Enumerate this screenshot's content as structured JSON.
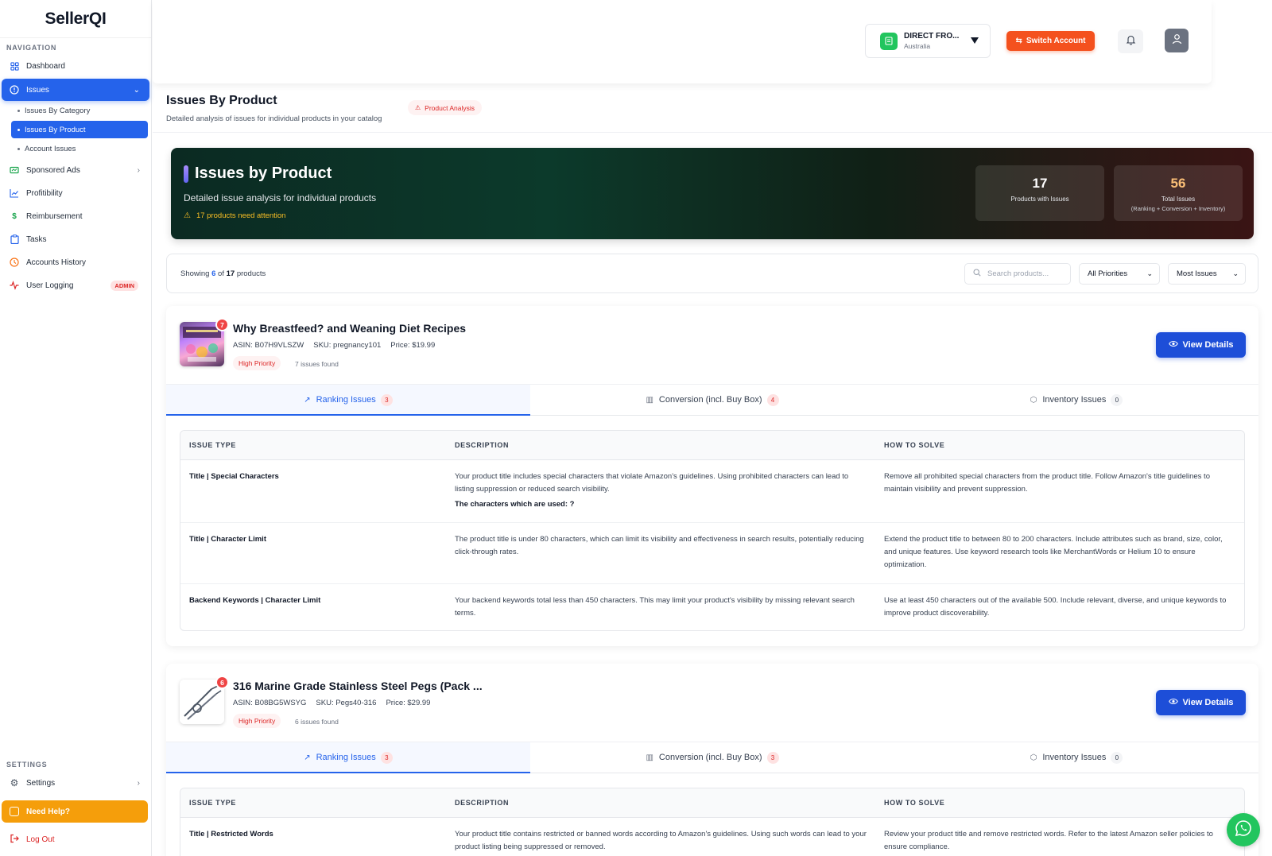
{
  "sidebar": {
    "logo": "SellerQI",
    "nav_label": "NAVIGATION",
    "items": [
      {
        "label": "Dashboard",
        "icon": "dashboard-icon"
      },
      {
        "label": "Issues",
        "icon": "alert-circle-icon"
      },
      {
        "label": "Sponsored Ads",
        "icon": "ads-icon"
      },
      {
        "label": "Profitibility",
        "icon": "chart-line-icon"
      },
      {
        "label": "Reimbursement",
        "icon": "dollar-icon"
      },
      {
        "label": "Tasks",
        "icon": "clipboard-icon"
      },
      {
        "label": "Accounts History",
        "icon": "history-icon"
      },
      {
        "label": "User Logging",
        "icon": "activity-icon"
      }
    ],
    "issues_sub": [
      {
        "label": "Issues By Category"
      },
      {
        "label": "Issues By Product"
      },
      {
        "label": "Account Issues"
      }
    ],
    "admin_badge": "ADMIN",
    "settings_label": "SETTINGS",
    "settings_item": "Settings",
    "help_label": "Need Help?",
    "logout_label": "Log Out"
  },
  "header": {
    "account_name": "DIRECT FRO...",
    "account_country": "Australia",
    "switch_label": "Switch Account"
  },
  "page": {
    "title": "Issues By Product",
    "subtitle": "Detailed analysis of issues for individual products in your catalog",
    "badge": "Product Analysis"
  },
  "hero": {
    "title": "Issues by Product",
    "subtitle": "Detailed issue analysis for individual products",
    "warning": "17 products need attention",
    "stats": [
      {
        "value": "17",
        "label": "Products with Issues",
        "sub": ""
      },
      {
        "value": "56",
        "label": "Total Issues",
        "sub": "(Ranking + Conversion + Inventory)"
      }
    ]
  },
  "filters": {
    "showing_prefix": "Showing",
    "showing_count": "6",
    "showing_of": "of",
    "showing_total": "17",
    "showing_suffix": "products",
    "search_placeholder": "Search products...",
    "priority_value": "All Priorities",
    "sort_value": "Most Issues"
  },
  "table_headers": {
    "issue_type": "ISSUE TYPE",
    "description": "DESCRIPTION",
    "how_to_solve": "HOW TO SOLVE"
  },
  "products": [
    {
      "issue_count": "7",
      "title": "Why Breastfeed? and Weaning Diet Recipes",
      "asin": "ASIN: B07H9VLSZW",
      "sku": "SKU: pregnancy101",
      "price": "Price: $19.99",
      "priority": "High Priority",
      "issues_found": "7 issues found",
      "view_label": "View Details",
      "tabs": [
        {
          "label": "Ranking Issues",
          "count": "3",
          "icon": "trend-up-icon"
        },
        {
          "label": "Conversion (incl. Buy Box)",
          "count": "4",
          "icon": "bar-chart-icon"
        },
        {
          "label": "Inventory Issues",
          "count": "0",
          "icon": "box-icon"
        }
      ],
      "rows": [
        {
          "type": "Title | Special Characters",
          "description": "Your product title includes special characters that violate Amazon's guidelines. Using prohibited characters can lead to listing suppression or reduced search visibility.",
          "extra": "The characters which are used: ?",
          "solve": "Remove all prohibited special characters from the product title. Follow Amazon's title guidelines to maintain visibility and prevent suppression."
        },
        {
          "type": "Title | Character Limit",
          "description": "The product title is under 80 characters, which can limit its visibility and effectiveness in search results, potentially reducing click-through rates.",
          "extra": "",
          "solve": "Extend the product title to between 80 to 200 characters. Include attributes such as brand, size, color, and unique features. Use keyword research tools like MerchantWords or Helium 10 to ensure optimization."
        },
        {
          "type": "Backend Keywords | Character Limit",
          "description": "Your backend keywords total less than 450 characters. This may limit your product's visibility by missing relevant search terms.",
          "extra": "",
          "solve": "Use at least 450 characters out of the available 500. Include relevant, diverse, and unique keywords to improve product discoverability."
        }
      ]
    },
    {
      "issue_count": "6",
      "title": "316 Marine Grade Stainless Steel Pegs (Pack ...",
      "asin": "ASIN: B08BG5WSYG",
      "sku": "SKU: Pegs40-316",
      "price": "Price: $29.99",
      "priority": "High Priority",
      "issues_found": "6 issues found",
      "view_label": "View Details",
      "tabs": [
        {
          "label": "Ranking Issues",
          "count": "3",
          "icon": "trend-up-icon"
        },
        {
          "label": "Conversion (incl. Buy Box)",
          "count": "3",
          "icon": "bar-chart-icon"
        },
        {
          "label": "Inventory Issues",
          "count": "0",
          "icon": "box-icon"
        }
      ],
      "rows": [
        {
          "type": "Title | Restricted Words",
          "description": "Your product title contains restricted or banned words according to Amazon's guidelines. Using such words can lead to your product listing being suppressed or removed.",
          "extra": "",
          "solve": "Review your product title and remove restricted words. Refer to the latest Amazon seller policies to ensure compliance."
        }
      ]
    }
  ],
  "colors": {
    "primary": "#2563eb",
    "orange": "#f4511e",
    "danger": "#dc2626",
    "help": "#f59e0b",
    "whatsapp": "#22c55e"
  }
}
